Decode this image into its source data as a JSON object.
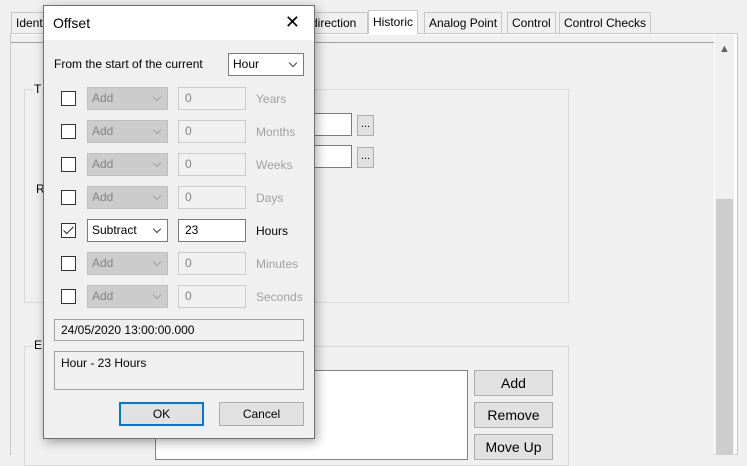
{
  "background": {
    "tabs": [
      {
        "label": "Ident"
      },
      {
        "label": "direction"
      },
      {
        "label": "Historic"
      },
      {
        "label": "Analog Point"
      },
      {
        "label": "Control"
      },
      {
        "label": "Control Checks"
      }
    ],
    "group1_label": "T",
    "group2_label": "R",
    "group3_label": "E",
    "dots_label": "...",
    "buttons": {
      "add": "Add",
      "remove": "Remove",
      "move_up": "Move Up"
    }
  },
  "dialog": {
    "title": "Offset",
    "close_glyph": "✕",
    "start_label": "From the start of the current",
    "start_unit": "Hour",
    "rows": [
      {
        "checked": false,
        "op": "Add",
        "value": "0",
        "unit": "Years"
      },
      {
        "checked": false,
        "op": "Add",
        "value": "0",
        "unit": "Months"
      },
      {
        "checked": false,
        "op": "Add",
        "value": "0",
        "unit": "Weeks"
      },
      {
        "checked": false,
        "op": "Add",
        "value": "0",
        "unit": "Days"
      },
      {
        "checked": true,
        "op": "Subtract",
        "value": "23",
        "unit": "Hours"
      },
      {
        "checked": false,
        "op": "Add",
        "value": "0",
        "unit": "Minutes"
      },
      {
        "checked": false,
        "op": "Add",
        "value": "0",
        "unit": "Seconds"
      }
    ],
    "result_datetime": "24/05/2020 13:00:00.000",
    "description": "Hour - 23 Hours",
    "ok_label": "OK",
    "cancel_label": "Cancel"
  },
  "colors": {
    "accent": "#0078d7",
    "disabled_text": "#a0a0a0"
  }
}
